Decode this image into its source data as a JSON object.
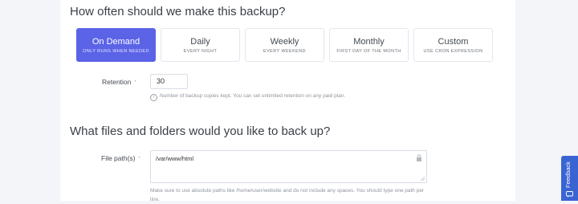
{
  "backup_schedule": {
    "heading": "How often should we make this backup?",
    "options": [
      {
        "title": "On Demand",
        "subtitle": "ONLY RUNS WHEN NEEDED",
        "selected": true
      },
      {
        "title": "Daily",
        "subtitle": "EVERY NIGHT",
        "selected": false
      },
      {
        "title": "Weekly",
        "subtitle": "EVERY WEEKEND",
        "selected": false
      },
      {
        "title": "Monthly",
        "subtitle": "FIRST DAY OF THE MONTH",
        "selected": false
      },
      {
        "title": "Custom",
        "subtitle": "USE CRON EXPRESSION",
        "selected": false
      }
    ],
    "accent_color": "#5b63e6"
  },
  "retention": {
    "label": "Retention",
    "required_mark": "*",
    "value": "30",
    "help_text": "Number of backup copies kept. You can set unlimited retention on any paid plan."
  },
  "files": {
    "heading": "What files and folders would you like to back up?",
    "label": "File path(s)",
    "required_mark": "*",
    "value": "/var/www/html",
    "help_text": "Make sure to use absolute paths like /home/user/website and do not include any spaces. You should type one path per line."
  },
  "feedback_tab": {
    "label": "Feedback",
    "color": "#3b64d3"
  }
}
